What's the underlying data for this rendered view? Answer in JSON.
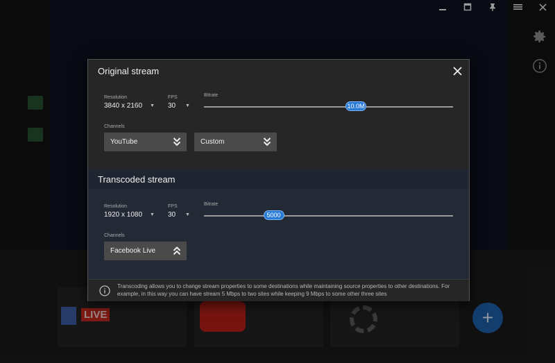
{
  "window_controls": [
    "minimize",
    "maximize",
    "pin",
    "menu",
    "close"
  ],
  "dialog": {
    "original": {
      "title": "Original stream",
      "resolution_label": "Resolution",
      "resolution_value": "3840 x 2160",
      "fps_label": "FPS",
      "fps_value": "30",
      "bitrate_label": "Bitrate",
      "bitrate_value": "10.0M",
      "bitrate_fraction": 0.61,
      "channels_label": "Channels",
      "channels": [
        "YouTube",
        "Custom"
      ]
    },
    "transcoded": {
      "title": "Transcoded stream",
      "resolution_label": "Resolution",
      "resolution_value": "1920 x 1080",
      "fps_label": "FPS",
      "fps_value": "30",
      "bitrate_label": "Bitrate",
      "bitrate_value": "5000",
      "bitrate_fraction": 0.28,
      "channels_label": "Channels",
      "channels": [
        "Facebook Live"
      ]
    },
    "info_text": "Transcoding allows you to change stream properties to some destinations while maintaining source properties to other destinations. For example, in this way you can have stream 5 Mbps to two sites while keeping 9 Mbps to some other three sites"
  },
  "background": {
    "destinations": [
      "facebook-live",
      "youtube",
      "custom"
    ],
    "fb_live_label": "LIVE"
  },
  "colors": {
    "accent": "#2a7bd8",
    "dialog_bg": "#262626",
    "transcoded_bg": "#232a36",
    "select_bg": "#4a4a4a"
  }
}
